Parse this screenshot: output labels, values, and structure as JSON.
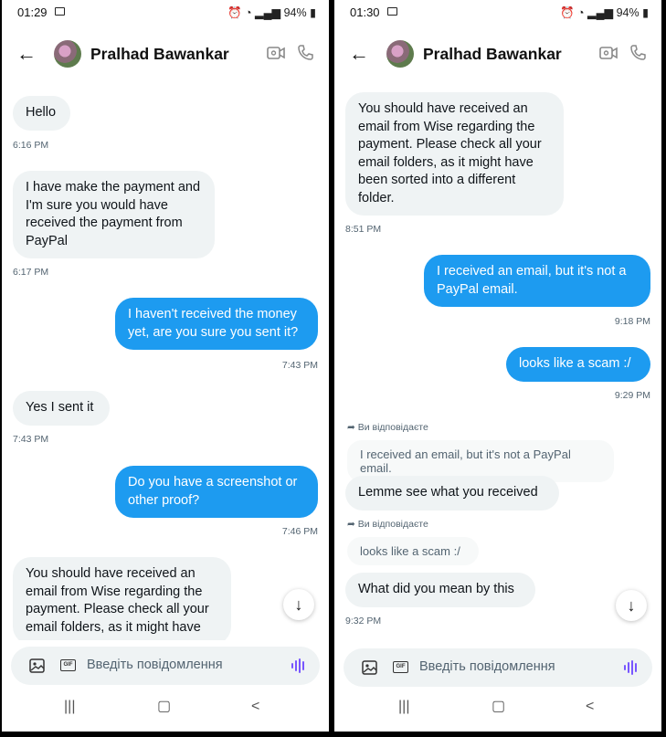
{
  "left": {
    "status": {
      "time": "01:29",
      "battery": "94%"
    },
    "header": {
      "name": "Pralhad Bawankar"
    },
    "messages": [
      {
        "type": "received",
        "text": "Hello",
        "time": "6:16 PM"
      },
      {
        "type": "received",
        "text": "I have make the payment and I'm sure you would have received the payment from PayPal",
        "time": "6:17 PM"
      },
      {
        "type": "sent",
        "text": "I haven't received the money yet, are you sure you sent it?",
        "time": "7:43 PM"
      },
      {
        "type": "received",
        "text": "Yes I sent it",
        "time": "7:43 PM"
      },
      {
        "type": "sent",
        "text": "Do you have a screenshot or other proof?",
        "time": "7:46 PM"
      },
      {
        "type": "received",
        "text": "You should have received an email from Wise regarding the payment. Please check all your email folders, as it might have"
      }
    ],
    "composer": {
      "placeholder": "Введіть повідомлення"
    }
  },
  "right": {
    "status": {
      "time": "01:30",
      "battery": "94%"
    },
    "header": {
      "name": "Pralhad Bawankar"
    },
    "messages": [
      {
        "type": "received",
        "text": "You should have received an email from Wise regarding the payment. Please check all your email folders, as it might have been sorted into a different folder.",
        "time": "8:51 PM"
      },
      {
        "type": "sent",
        "text": "I received an email, but it's not a PayPal email.",
        "time": "9:18 PM"
      },
      {
        "type": "sent",
        "text": "looks like a scam :/",
        "time": "9:29 PM"
      },
      {
        "type": "reply",
        "label": "Ви відповідаєте",
        "quoted": "I received an email, but it's not a PayPal email.",
        "text": "Lemme see what you received"
      },
      {
        "type": "reply",
        "label": "Ви відповідаєте",
        "quoted": "looks like a scam :/",
        "text": "What did you mean by this",
        "time": "9:32 PM"
      }
    ],
    "composer": {
      "placeholder": "Введіть повідомлення"
    }
  },
  "icons": {
    "back": "back-arrow-icon",
    "video": "video-call-icon",
    "call": "phone-call-icon",
    "image": "image-icon",
    "gif": "gif-icon",
    "voice": "voice-icon",
    "scroll": "scroll-down-icon"
  },
  "colors": {
    "sent_bubble": "#1d9bf0",
    "received_bubble": "#eff3f4",
    "voice_icon": "#7856ff"
  }
}
